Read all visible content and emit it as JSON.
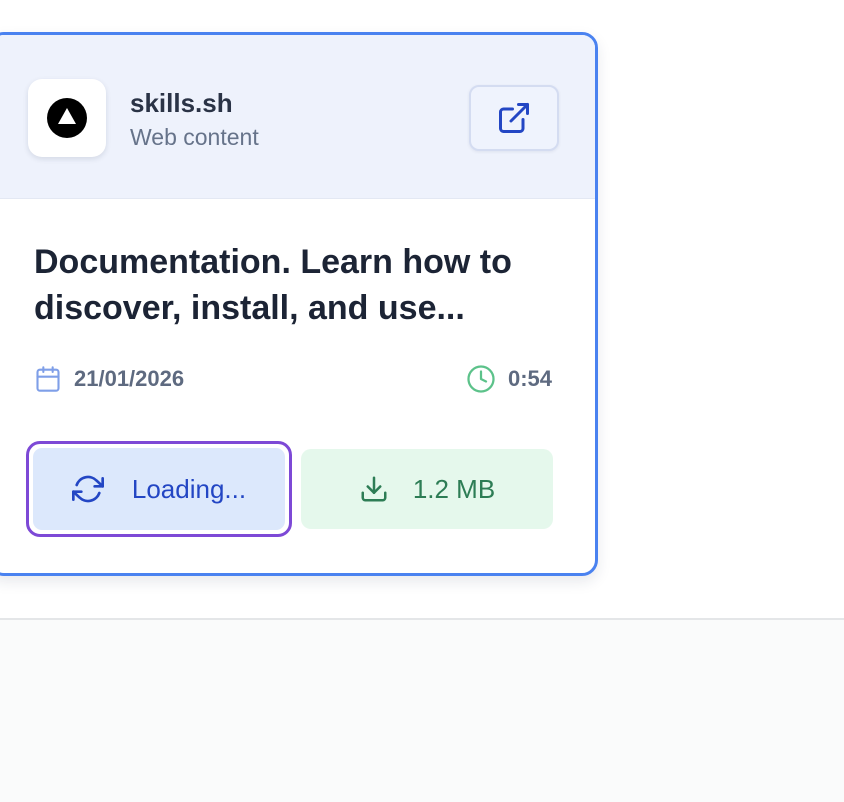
{
  "card": {
    "site": {
      "name": "skills.sh",
      "type": "Web content",
      "favicon_icon": "circle-triangle-icon"
    },
    "open_icon": "external-link-icon",
    "title": "Documentation. Learn how to discover, install, and use...",
    "date": "21/01/2026",
    "date_icon": "calendar-icon",
    "duration": "0:54",
    "duration_icon": "clock-icon",
    "loading_label": "Loading...",
    "loading_icon": "refresh-icon",
    "download_label": "1.2 MB",
    "download_icon": "download-icon"
  },
  "colors": {
    "card_border": "#4a82f0",
    "focus_ring": "#7d49d6",
    "loading_text": "#2346c4",
    "download_text": "#2d7d55"
  }
}
